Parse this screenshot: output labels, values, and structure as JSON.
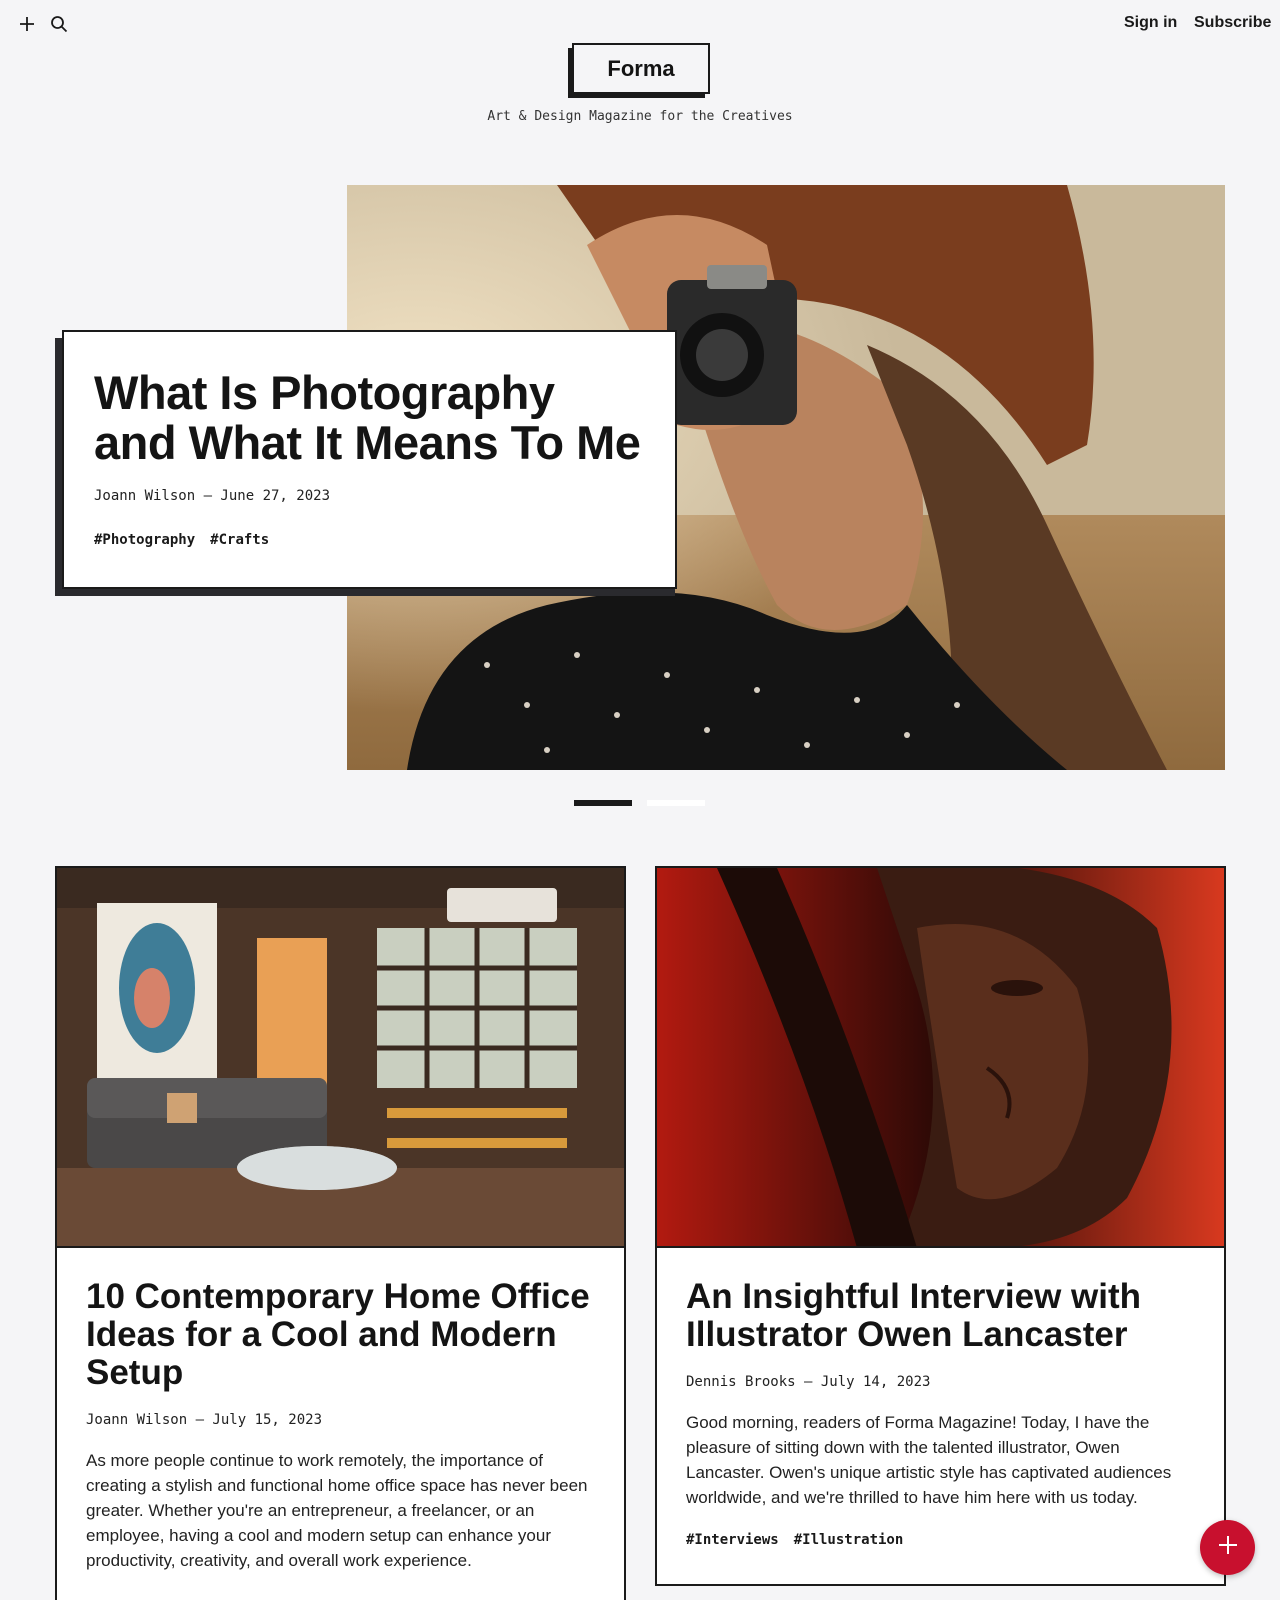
{
  "header": {
    "sign_in": "Sign in",
    "subscribe": "Subscribe",
    "logo": "Forma",
    "tagline": "Art & Design Magazine for the Creatives"
  },
  "hero": {
    "title": "What Is Photography and What It Means To Me",
    "meta": "Joann Wilson — June 27, 2023",
    "tags": [
      "#Photography",
      "#Crafts"
    ],
    "slider_active_index": 1,
    "slider_count": 2
  },
  "cards": [
    {
      "title": "10 Contemporary Home Office Ideas for a Cool and Modern Setup",
      "meta": "Joann Wilson — July 15, 2023",
      "excerpt": "As more people continue to work remotely, the importance of creating a stylish and functional home office space has never been greater. Whether you're an entrepreneur, a freelancer, or an employee, having a cool and modern setup can enhance your productivity, creativity, and overall work experience."
    },
    {
      "title": "An Insightful Interview with Illustrator Owen Lancaster",
      "meta": "Dennis Brooks — July 14, 2023",
      "excerpt": "Good morning, readers of Forma Magazine! Today, I have the pleasure of sitting down with the talented illustrator, Owen Lancaster. Owen's unique artistic style has captivated audiences worldwide, and we're thrilled to have him here with us today.",
      "tags": [
        "#Interviews",
        "#Illustration"
      ]
    }
  ],
  "icons": {
    "top_left": [
      "plus-icon",
      "search-icon"
    ],
    "fab": "plus-icon"
  },
  "colors": {
    "background": "#f5f5f7",
    "ink": "#1a1a1a",
    "fab": "#c8102e"
  }
}
